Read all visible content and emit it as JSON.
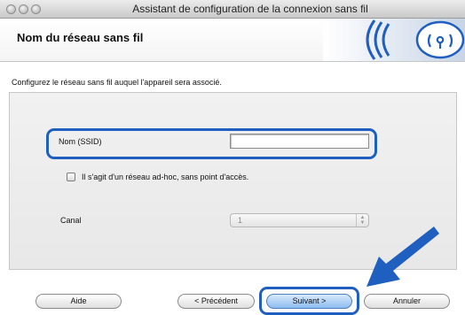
{
  "window": {
    "title": "Assistant de configuration de la connexion sans fil"
  },
  "header": {
    "title": "Nom du réseau sans fil",
    "logo_icon": "wireless-signal-icon",
    "accent_color": "#1f5fbf"
  },
  "instructions": "Configurez le réseau sans fil auquel l'appareil sera associé.",
  "form": {
    "ssid_label": "Nom (SSID)",
    "ssid_value": "",
    "adhoc_label": "Il s'agit d'un réseau ad-hoc, sans point d'accès.",
    "adhoc_checked": false,
    "channel_label": "Canal",
    "channel_value": "1"
  },
  "buttons": {
    "help": "Aide",
    "previous": "< Précédent",
    "next": "Suivant >",
    "cancel": "Annuler"
  }
}
